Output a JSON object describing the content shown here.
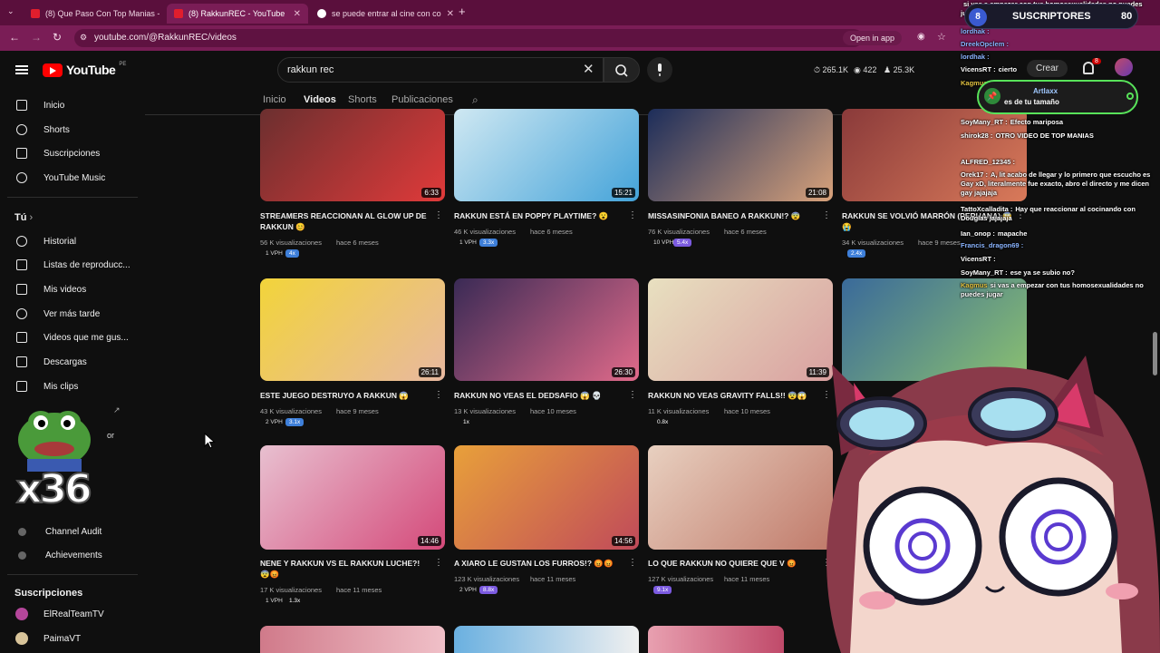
{
  "browser": {
    "tabs": [
      {
        "label": "(8) Que Paso Con Top Manias -",
        "active": false
      },
      {
        "label": "(8) RakkunREC - YouTube",
        "active": true
      },
      {
        "label": "se puede entrar al cine con co",
        "active": false
      }
    ],
    "new_tab": "+",
    "url": "youtube.com/@RakkunREC/videos",
    "open_in_app": "Open in app"
  },
  "header": {
    "logo_text": "YouTube",
    "country": "PE",
    "search_value": "rakkun rec",
    "stats": [
      "265.1K",
      "422",
      "25.3K"
    ],
    "create_label": "Crear",
    "notif_count": "8"
  },
  "sidebar": {
    "main": [
      {
        "label": "Inicio",
        "icon": "home-icon"
      },
      {
        "label": "Shorts",
        "icon": "shorts-icon"
      },
      {
        "label": "Suscripciones",
        "icon": "subscriptions-icon"
      },
      {
        "label": "YouTube Music",
        "icon": "music-icon"
      }
    ],
    "you_heading": "Tú",
    "you": [
      {
        "label": "Historial",
        "icon": "history-icon"
      },
      {
        "label": "Listas de reproducc...",
        "icon": "playlists-icon"
      },
      {
        "label": "Mis videos",
        "icon": "my-videos-icon"
      },
      {
        "label": "Ver más tarde",
        "icon": "watch-later-icon"
      },
      {
        "label": "Videos que me gus...",
        "icon": "liked-icon"
      },
      {
        "label": "Descargas",
        "icon": "downloads-icon"
      },
      {
        "label": "Mis clips",
        "icon": "clips-icon"
      }
    ],
    "partial_label": "or",
    "extensions": [
      {
        "label": "Channel Audit"
      },
      {
        "label": "Achievements"
      }
    ],
    "subs_heading": "Suscripciones",
    "subs": [
      {
        "label": "ElRealTeamTV"
      },
      {
        "label": "PaimaVT"
      }
    ]
  },
  "channel_tabs": [
    "Inicio",
    "Videos",
    "Shorts",
    "Publicaciones"
  ],
  "videos": [
    {
      "title": "STREAMERS REACCIONAN AL GLOW UP DE RAKKUN 😊",
      "views": "56 K visualizaciones",
      "ago": "hace 6 meses",
      "vph": "1 VPH",
      "mult": "4x",
      "mult_color": "#3e7fd9",
      "duration": "6:33",
      "colors": [
        "#6b2f2f",
        "#e03a3a"
      ]
    },
    {
      "title": "RAKKUN ESTÁ EN POPPY PLAYTIME? 😮",
      "views": "46 K visualizaciones",
      "ago": "hace 6 meses",
      "vph": "1 VPH",
      "mult": "3.3x",
      "mult_color": "#3e7fd9",
      "duration": "15:21",
      "colors": [
        "#cfe8f2",
        "#44a3d9"
      ]
    },
    {
      "title": "MISSASINFONIA BANEO A RAKKUN!? 😨",
      "views": "76 K visualizaciones",
      "ago": "hace 6 meses",
      "vph": "10 VPH",
      "mult": "5.4x",
      "mult_color": "#7b5ae0",
      "duration": "21:08",
      "colors": [
        "#1c2d5a",
        "#d8a27b"
      ]
    },
    {
      "title": "RAKKUN SE VOLVIÓ MARRÓN (PERUANA) 😱😭",
      "views": "34 K visualizaciones",
      "ago": "hace 9 meses",
      "vph": "",
      "mult": "2.4x",
      "mult_color": "#3e7fd9",
      "duration": "",
      "colors": [
        "#8a3a3a",
        "#d97a5a"
      ]
    },
    {
      "title": "ESTE JUEGO DESTRUYO A RAKKUN 😱",
      "views": "43 K visualizaciones",
      "ago": "hace 9 meses",
      "vph": "2 VPH",
      "mult": "3.1x",
      "mult_color": "#3e7fd9",
      "duration": "26:11",
      "colors": [
        "#f2d43a",
        "#e8b8a0"
      ]
    },
    {
      "title": "RAKKUN NO VEAS EL DEDSAFIO 😱 💀",
      "views": "13 K visualizaciones",
      "ago": "hace 10 meses",
      "vph": "",
      "mult": "1x",
      "mult_color": "transparent",
      "duration": "26:30",
      "colors": [
        "#3a2a55",
        "#e06a8a"
      ]
    },
    {
      "title": "RAKKUN NO VEAS GRAVITY FALLS!! 😨😱",
      "views": "11 K visualizaciones",
      "ago": "hace 10 meses",
      "vph": "",
      "mult": "0.8x",
      "mult_color": "transparent",
      "duration": "11:39",
      "colors": [
        "#e8e0c0",
        "#d9a0a0"
      ]
    },
    {
      "title": "",
      "views": "",
      "ago": "",
      "vph": "",
      "mult": "",
      "mult_color": "transparent",
      "duration": "",
      "colors": [
        "#3a6a9a",
        "#8ac070"
      ]
    },
    {
      "title": "NENE Y RAKKUN VS EL RAKKUN LUCHE?! 😨😡",
      "views": "17 K visualizaciones",
      "ago": "hace 11 meses",
      "vph": "1 VPH",
      "mult": "1.3x",
      "mult_color": "transparent",
      "duration": "14:46",
      "colors": [
        "#e8c0d0",
        "#d44a7a"
      ]
    },
    {
      "title": "A XIARO LE GUSTAN LOS FURROS!? 😡😡",
      "views": "123 K visualizaciones",
      "ago": "hace 11 meses",
      "vph": "2 VPH",
      "mult": "8.8x",
      "mult_color": "#7b5ae0",
      "duration": "14:56",
      "colors": [
        "#e8a03a",
        "#c04a5a"
      ]
    },
    {
      "title": "LO QUE RAKKUN NO QUIERE QUE V 😡",
      "views": "127 K visualizaciones",
      "ago": "hace 11 meses",
      "vph": "",
      "mult": "9.1x",
      "mult_color": "#7b5ae0",
      "duration": "",
      "colors": [
        "#e8d0c0",
        "#c07a6a"
      ]
    }
  ],
  "chat": {
    "subs_label": "SUSCRIPTORES",
    "subs_left": "8",
    "subs_right": "80",
    "pinned_user": "Artlaxx",
    "pinned_msg": "es de tu tamaño",
    "lines": [
      {
        "user": "",
        "msg": "si vas a empezar con tus homosexualidades no puedes jugar",
        "color": "#fff"
      },
      {
        "user": "lordhak :",
        "msg": "",
        "color": "#8ab4ff"
      },
      {
        "user": "DreekOpclem :",
        "msg": "",
        "color": "#8ab4ff"
      },
      {
        "user": "lordhak :",
        "msg": "",
        "color": "#8ab4ff"
      },
      {
        "user": "VicensRT :",
        "msg": "cierto",
        "color": "#fff"
      },
      {
        "user": "Kagmus",
        "msg": "",
        "color": "#e0c040"
      },
      {
        "user": "SoyMany_RT :",
        "msg": "Efecto mariposa",
        "color": "#fff"
      },
      {
        "user": "shirok28 :",
        "msg": "OTRO VIDEO DE TOP MANIAS",
        "color": "#fff"
      },
      {
        "user": "",
        "msg": "",
        "color": "#8ab4ff"
      },
      {
        "user": "ALFRED_12345 :",
        "msg": "",
        "color": "#fff"
      },
      {
        "user": "Orek17 :",
        "msg": "A, lit acabo de llegar y lo primero que escucho es Gay xD, literalmente fue exacto, abro el directo y me dicen gay jajajaja",
        "color": "#fff"
      },
      {
        "user": "TattoXcalladita :",
        "msg": "Hay que reaccionar al cocinando con Douglas jajajaja",
        "color": "#fff"
      },
      {
        "user": "Ian_onop :",
        "msg": "mapache",
        "color": "#fff"
      },
      {
        "user": "Francis_dragon69 :",
        "msg": "",
        "color": "#8ab4ff"
      },
      {
        "user": "VicensRT :",
        "msg": "",
        "color": "#fff"
      },
      {
        "user": "SoyMany_RT :",
        "msg": "ese ya se subio no?",
        "color": "#fff"
      },
      {
        "user": "Kagmus",
        "msg": "si vas a empezar con tus homosexualidades no puedes jugar",
        "color": "#e0c040"
      }
    ]
  },
  "overlay": {
    "pepe_count": "x36"
  }
}
